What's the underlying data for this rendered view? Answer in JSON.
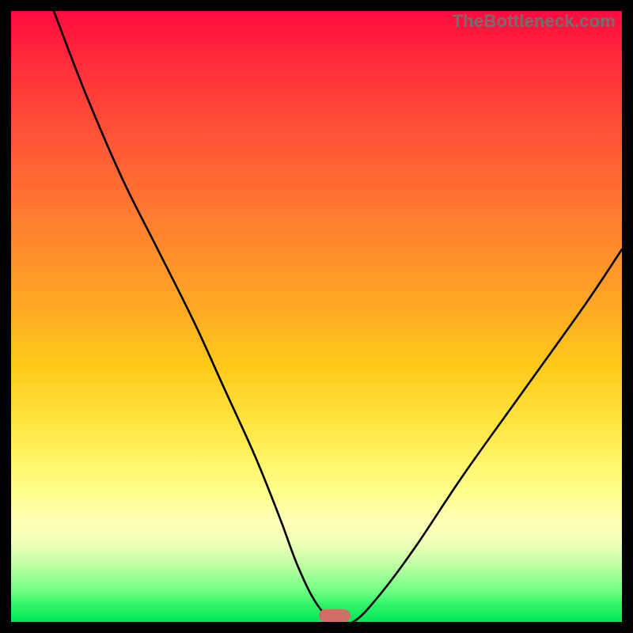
{
  "attribution": "TheBottleneck.com",
  "marker": {
    "x_pct": 53,
    "y_pct": 99,
    "color": "#cf6f67"
  },
  "chart_data": {
    "type": "line",
    "title": "",
    "xlabel": "",
    "ylabel": "",
    "xlim": [
      0,
      100
    ],
    "ylim": [
      0,
      100
    ],
    "grid": false,
    "legend": false,
    "series": [
      {
        "name": "bottleneck-curve",
        "x": [
          7,
          12,
          18,
          24,
          30,
          35,
          40,
          44,
          47,
          50,
          53,
          56,
          60,
          66,
          74,
          84,
          94,
          100
        ],
        "y": [
          100,
          87,
          73,
          61,
          49,
          38,
          27,
          17,
          9,
          3,
          0,
          0,
          4,
          12,
          24,
          38,
          52,
          61
        ]
      }
    ],
    "annotations": [
      {
        "text": "TheBottleneck.com",
        "position": "top-right"
      }
    ]
  }
}
